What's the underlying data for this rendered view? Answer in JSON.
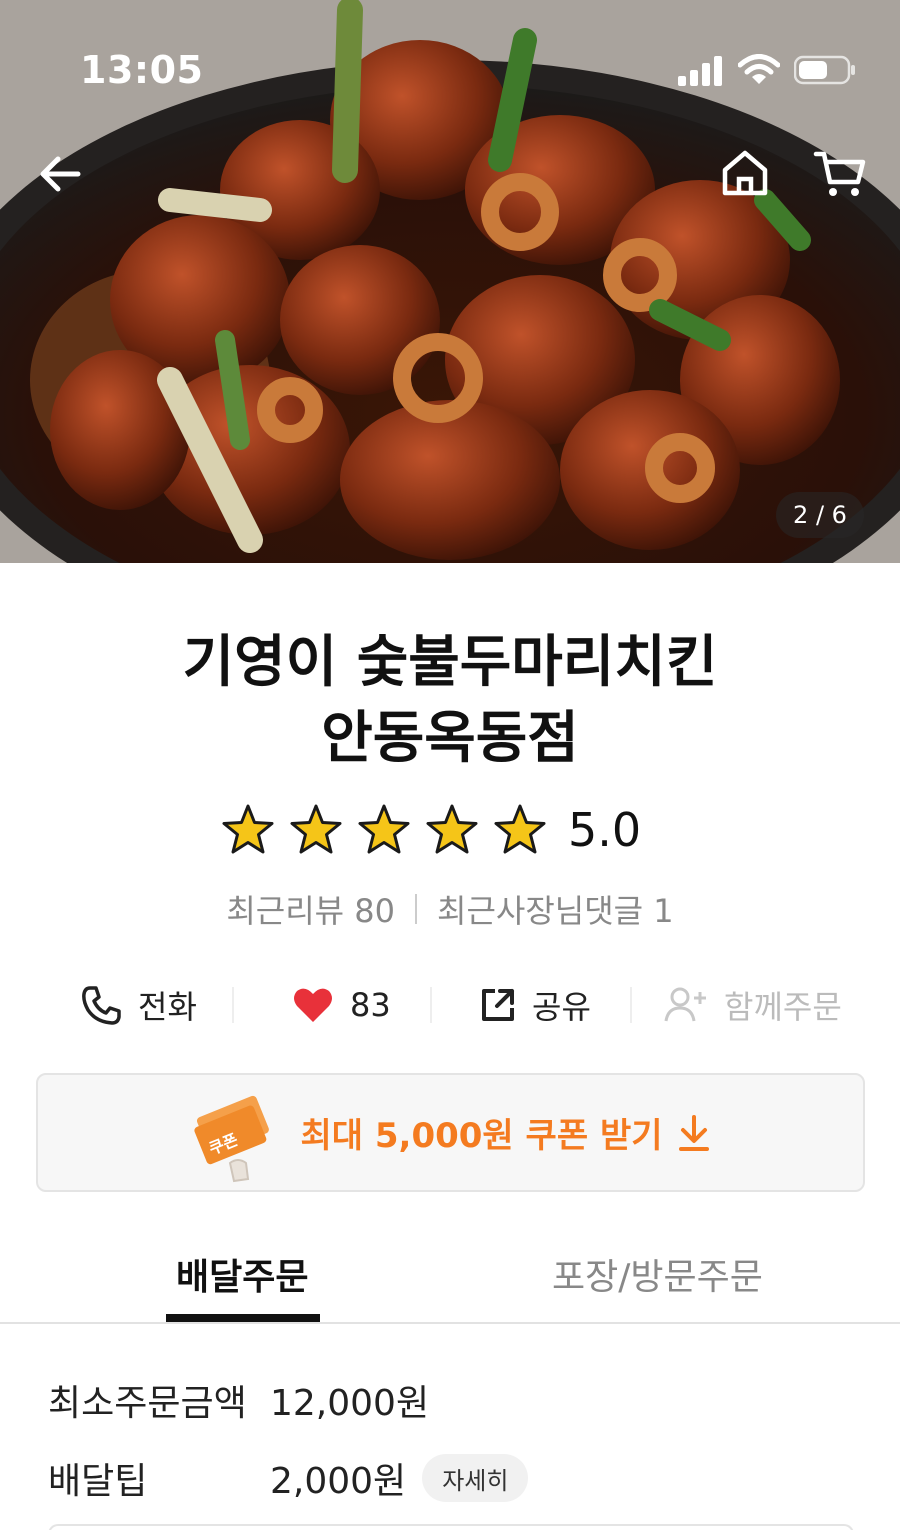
{
  "status_bar": {
    "time": "13:05",
    "battery_level": 0.6
  },
  "hero": {
    "page_indicator": "2 / 6"
  },
  "store": {
    "name_line1": "기영이 숯불두마리치킨",
    "name_line2": "안동옥동점",
    "rating": 5.0,
    "rating_text": "5.0",
    "stars": 5,
    "recent_reviews": "최근리뷰 80",
    "owner_replies": "최근사장님댓글 1"
  },
  "actions": {
    "call_label": "전화",
    "like_count": "83",
    "share_label": "공유",
    "group_order_label": "함께주문"
  },
  "coupon": {
    "label": "최대 5,000원 쿠폰 받기",
    "ticket_text": "쿠폰"
  },
  "tabs": [
    {
      "label": "배달주문",
      "active": true
    },
    {
      "label": "포장/방문주문",
      "active": false
    }
  ],
  "delivery_info": {
    "min_order_label": "최소주문금액",
    "min_order_value": "12,000원",
    "delivery_tip_label": "배달팁",
    "delivery_tip_value": "2,000원",
    "detail_button": "자세히"
  },
  "colors": {
    "accent": "#f47b20",
    "star": "#f5c518",
    "heart": "#e8313a"
  }
}
